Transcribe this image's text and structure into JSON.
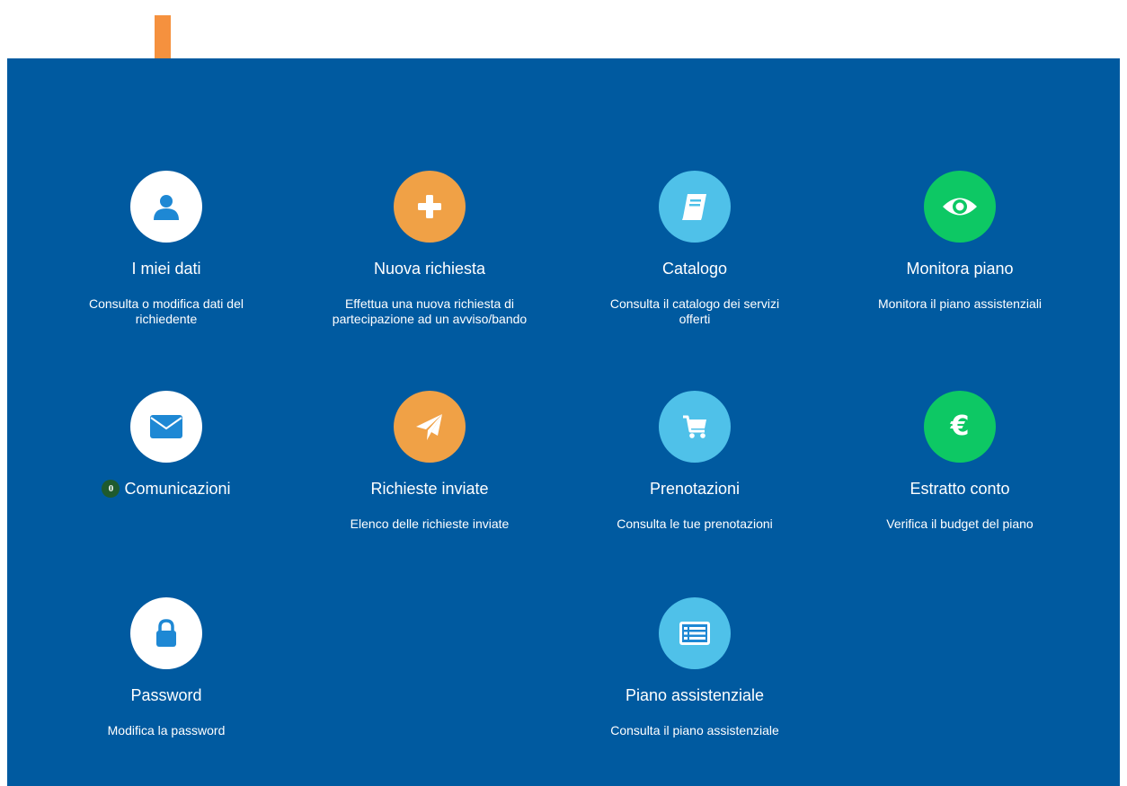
{
  "colors": {
    "panel_bg": "#005aa0",
    "white": "#ffffff",
    "orange": "#f0a146",
    "light_blue": "#4fc1e9",
    "green": "#0dc864",
    "icon_blue": "#1e88d4",
    "badge_green": "#1f5a2e",
    "arrow_orange": "#f5913e"
  },
  "tiles": [
    {
      "title": "I miei dati",
      "desc": "Consulta o modifica dati del richiedente",
      "icon": "user-icon",
      "color": "white"
    },
    {
      "title": "Nuova richiesta",
      "desc": "Effettua una nuova richiesta di partecipazione ad un avviso/bando",
      "icon": "plus-icon",
      "color": "orange"
    },
    {
      "title": "Catalogo",
      "desc": "Consulta il catalogo dei servizi offerti",
      "icon": "book-icon",
      "color": "light_blue"
    },
    {
      "title": "Monitora piano",
      "desc": "Monitora il piano assistenziali",
      "icon": "eye-icon",
      "color": "green"
    },
    {
      "title": "Comunicazioni",
      "badge": "0",
      "desc": "",
      "icon": "envelope-icon",
      "color": "white"
    },
    {
      "title": "Richieste inviate",
      "desc": "Elenco delle richieste inviate",
      "icon": "paper-plane-icon",
      "color": "orange"
    },
    {
      "title": "Prenotazioni",
      "desc": "Consulta le tue prenotazioni",
      "icon": "cart-icon",
      "color": "light_blue"
    },
    {
      "title": "Estratto conto",
      "desc": "Verifica il budget del piano",
      "icon": "euro-icon",
      "color": "green"
    },
    {
      "title": "Password",
      "desc": "Modifica la password",
      "icon": "lock-icon",
      "color": "white"
    },
    {
      "title": "Piano assistenziale",
      "desc": "Consulta il piano assistenziale",
      "icon": "list-icon",
      "color": "light_blue"
    }
  ]
}
